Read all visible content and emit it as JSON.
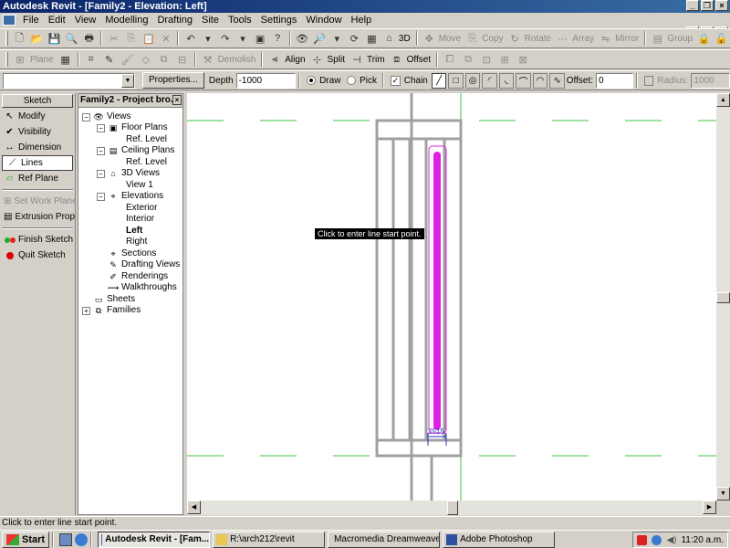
{
  "window": {
    "title": "Autodesk Revit - [Family2 - Elevation: Left]"
  },
  "menu": [
    "File",
    "Edit",
    "View",
    "Modelling",
    "Drafting",
    "Site",
    "Tools",
    "Settings",
    "Window",
    "Help"
  ],
  "toolbar1": {
    "view_3d": "3D",
    "move": "Move",
    "copy": "Copy",
    "rotate": "Rotate",
    "array": "Array",
    "mirror": "Mirror",
    "group": "Group"
  },
  "toolbar2": {
    "plane": "Plane",
    "demolish": "Demolish",
    "align": "Align",
    "split": "Split",
    "trim": "Trim",
    "offset": "Offset"
  },
  "options": {
    "properties": "Properties...",
    "depth_label": "Depth",
    "depth_value": "-1000",
    "draw": "Draw",
    "pick": "Pick",
    "chain": "Chain",
    "offset_label": "Offset:",
    "offset_value": "0",
    "radius_label": "Radius:",
    "radius_value": "1000"
  },
  "sketch": {
    "header": "Sketch",
    "items": [
      "Modify",
      "Visibility",
      "Dimension",
      "Lines",
      "Ref Plane",
      "Set Work Plane",
      "Extrusion Prope",
      "Finish Sketch",
      "Quit Sketch"
    ]
  },
  "browser": {
    "title": "Family2 - Project bro...",
    "views": "Views",
    "floor_plans": "Floor Plans",
    "fp_ref_level": "Ref. Level",
    "ceiling_plans": "Ceiling Plans",
    "cp_ref_level": "Ref. Level",
    "views_3d": "3D Views",
    "view1": "View 1",
    "elevations": "Elevations",
    "exterior": "Exterior",
    "interior": "Interior",
    "left": "Left",
    "right": "Right",
    "sections": "Sections",
    "drafting_views": "Drafting Views",
    "renderings": "Renderings",
    "walkthroughs": "Walkthroughs",
    "sheets": "Sheets",
    "families": "Families"
  },
  "canvas": {
    "tooltip": "Click to enter line start point.",
    "dim_label": "2515"
  },
  "status": "Click to enter line start point.",
  "taskbar": {
    "start": "Start",
    "tasks": [
      "Autodesk Revit - [Fam...",
      "R:\\arch212\\revit",
      "Macromedia Dreamweave...",
      "Adobe Photoshop"
    ],
    "clock": "11:20 a.m."
  },
  "colors": {
    "sketch_line": "#e020e0",
    "ref_level": "#40c040",
    "geometry": "#a0a0a0",
    "dim": "#2030c0"
  }
}
